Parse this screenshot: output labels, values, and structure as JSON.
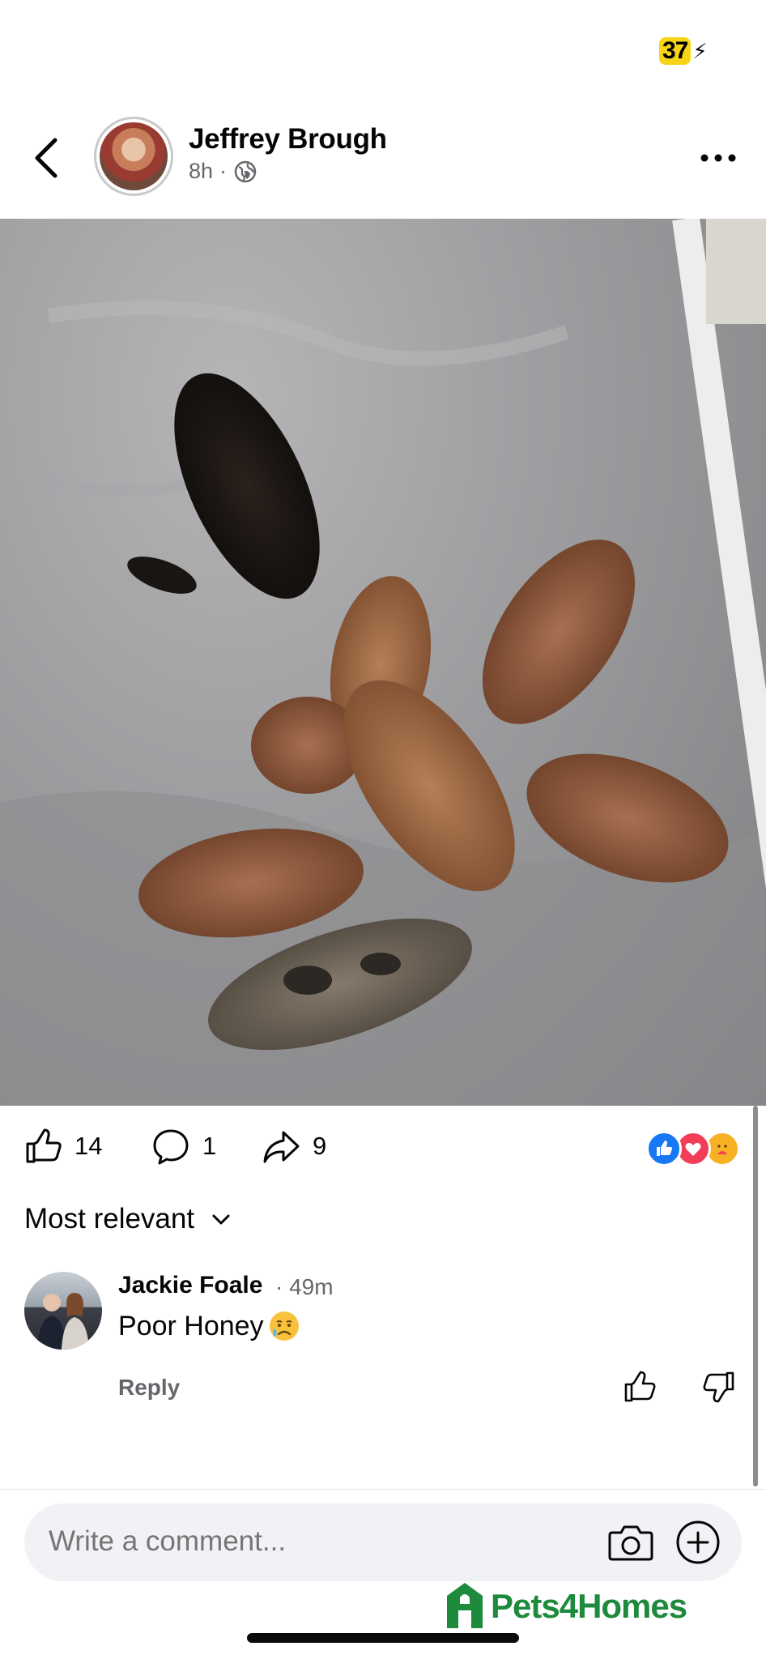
{
  "status_bar": {
    "battery_level": "37",
    "charging_symbol": "⚡"
  },
  "post": {
    "author": "Jeffrey Brough",
    "time": "8h",
    "separator": "·",
    "privacy_icon": "globe-icon",
    "media_alt": "puppies-video",
    "likes": "14",
    "comments": "1",
    "shares": "9",
    "reactions": [
      "like",
      "love",
      "care"
    ]
  },
  "comments_section": {
    "sort_label": "Most relevant",
    "items": [
      {
        "author": "Jackie Foale",
        "time": "· 49m",
        "text": "Poor Honey",
        "emoji": "sad-tear",
        "reply_label": "Reply"
      }
    ]
  },
  "composer": {
    "placeholder": "Write a comment..."
  },
  "watermark": {
    "brand": "Pets4Homes"
  },
  "colors": {
    "like_blue": "#1877f2",
    "love_red": "#f33e58",
    "brand_green": "#1d8a3c"
  }
}
